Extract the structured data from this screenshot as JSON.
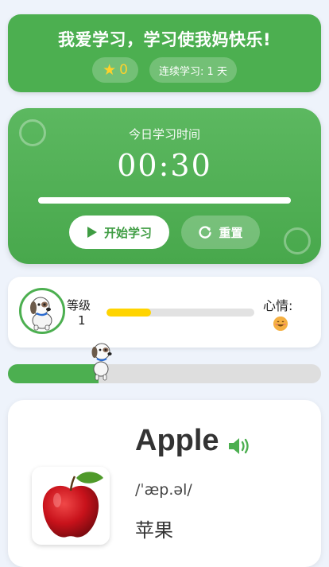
{
  "header": {
    "title": "我爱学习，学习使我妈快乐!",
    "star_count": "0",
    "streak": "连续学习: 1 天"
  },
  "timer": {
    "label": "今日学习时间",
    "value": "00:30",
    "progress_fraction": 1.0,
    "start_label": "开始学习",
    "reset_label": "重置"
  },
  "level": {
    "label": "等级",
    "value": "1",
    "xp_fraction": 0.3,
    "mood_label": "心情:"
  },
  "path": {
    "progress_fraction": 0.29
  },
  "word": {
    "text": "Apple",
    "phonetic": "/ˈæp.əl/",
    "meaning": "苹果"
  },
  "colors": {
    "primary": "#4caf50",
    "accent_gold": "#ffd400"
  }
}
